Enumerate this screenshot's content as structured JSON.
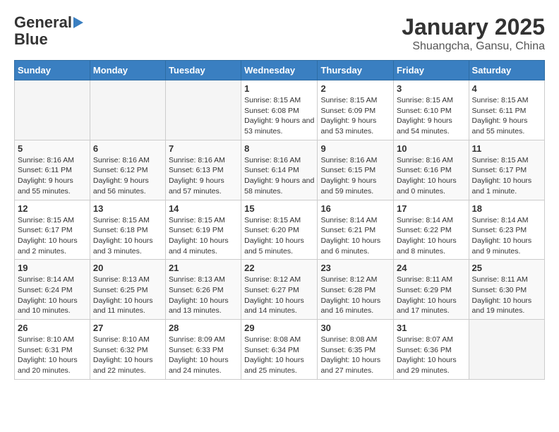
{
  "logo": {
    "line1": "General",
    "line2": "Blue"
  },
  "title": "January 2025",
  "subtitle": "Shuangcha, Gansu, China",
  "days_of_week": [
    "Sunday",
    "Monday",
    "Tuesday",
    "Wednesday",
    "Thursday",
    "Friday",
    "Saturday"
  ],
  "weeks": [
    [
      {
        "day": "",
        "info": ""
      },
      {
        "day": "",
        "info": ""
      },
      {
        "day": "",
        "info": ""
      },
      {
        "day": "1",
        "info": "Sunrise: 8:15 AM\nSunset: 6:08 PM\nDaylight: 9 hours and 53 minutes."
      },
      {
        "day": "2",
        "info": "Sunrise: 8:15 AM\nSunset: 6:09 PM\nDaylight: 9 hours and 53 minutes."
      },
      {
        "day": "3",
        "info": "Sunrise: 8:15 AM\nSunset: 6:10 PM\nDaylight: 9 hours and 54 minutes."
      },
      {
        "day": "4",
        "info": "Sunrise: 8:15 AM\nSunset: 6:11 PM\nDaylight: 9 hours and 55 minutes."
      }
    ],
    [
      {
        "day": "5",
        "info": "Sunrise: 8:16 AM\nSunset: 6:11 PM\nDaylight: 9 hours and 55 minutes."
      },
      {
        "day": "6",
        "info": "Sunrise: 8:16 AM\nSunset: 6:12 PM\nDaylight: 9 hours and 56 minutes."
      },
      {
        "day": "7",
        "info": "Sunrise: 8:16 AM\nSunset: 6:13 PM\nDaylight: 9 hours and 57 minutes."
      },
      {
        "day": "8",
        "info": "Sunrise: 8:16 AM\nSunset: 6:14 PM\nDaylight: 9 hours and 58 minutes."
      },
      {
        "day": "9",
        "info": "Sunrise: 8:16 AM\nSunset: 6:15 PM\nDaylight: 9 hours and 59 minutes."
      },
      {
        "day": "10",
        "info": "Sunrise: 8:16 AM\nSunset: 6:16 PM\nDaylight: 10 hours and 0 minutes."
      },
      {
        "day": "11",
        "info": "Sunrise: 8:15 AM\nSunset: 6:17 PM\nDaylight: 10 hours and 1 minute."
      }
    ],
    [
      {
        "day": "12",
        "info": "Sunrise: 8:15 AM\nSunset: 6:17 PM\nDaylight: 10 hours and 2 minutes."
      },
      {
        "day": "13",
        "info": "Sunrise: 8:15 AM\nSunset: 6:18 PM\nDaylight: 10 hours and 3 minutes."
      },
      {
        "day": "14",
        "info": "Sunrise: 8:15 AM\nSunset: 6:19 PM\nDaylight: 10 hours and 4 minutes."
      },
      {
        "day": "15",
        "info": "Sunrise: 8:15 AM\nSunset: 6:20 PM\nDaylight: 10 hours and 5 minutes."
      },
      {
        "day": "16",
        "info": "Sunrise: 8:14 AM\nSunset: 6:21 PM\nDaylight: 10 hours and 6 minutes."
      },
      {
        "day": "17",
        "info": "Sunrise: 8:14 AM\nSunset: 6:22 PM\nDaylight: 10 hours and 8 minutes."
      },
      {
        "day": "18",
        "info": "Sunrise: 8:14 AM\nSunset: 6:23 PM\nDaylight: 10 hours and 9 minutes."
      }
    ],
    [
      {
        "day": "19",
        "info": "Sunrise: 8:14 AM\nSunset: 6:24 PM\nDaylight: 10 hours and 10 minutes."
      },
      {
        "day": "20",
        "info": "Sunrise: 8:13 AM\nSunset: 6:25 PM\nDaylight: 10 hours and 11 minutes."
      },
      {
        "day": "21",
        "info": "Sunrise: 8:13 AM\nSunset: 6:26 PM\nDaylight: 10 hours and 13 minutes."
      },
      {
        "day": "22",
        "info": "Sunrise: 8:12 AM\nSunset: 6:27 PM\nDaylight: 10 hours and 14 minutes."
      },
      {
        "day": "23",
        "info": "Sunrise: 8:12 AM\nSunset: 6:28 PM\nDaylight: 10 hours and 16 minutes."
      },
      {
        "day": "24",
        "info": "Sunrise: 8:11 AM\nSunset: 6:29 PM\nDaylight: 10 hours and 17 minutes."
      },
      {
        "day": "25",
        "info": "Sunrise: 8:11 AM\nSunset: 6:30 PM\nDaylight: 10 hours and 19 minutes."
      }
    ],
    [
      {
        "day": "26",
        "info": "Sunrise: 8:10 AM\nSunset: 6:31 PM\nDaylight: 10 hours and 20 minutes."
      },
      {
        "day": "27",
        "info": "Sunrise: 8:10 AM\nSunset: 6:32 PM\nDaylight: 10 hours and 22 minutes."
      },
      {
        "day": "28",
        "info": "Sunrise: 8:09 AM\nSunset: 6:33 PM\nDaylight: 10 hours and 24 minutes."
      },
      {
        "day": "29",
        "info": "Sunrise: 8:08 AM\nSunset: 6:34 PM\nDaylight: 10 hours and 25 minutes."
      },
      {
        "day": "30",
        "info": "Sunrise: 8:08 AM\nSunset: 6:35 PM\nDaylight: 10 hours and 27 minutes."
      },
      {
        "day": "31",
        "info": "Sunrise: 8:07 AM\nSunset: 6:36 PM\nDaylight: 10 hours and 29 minutes."
      },
      {
        "day": "",
        "info": ""
      }
    ]
  ]
}
